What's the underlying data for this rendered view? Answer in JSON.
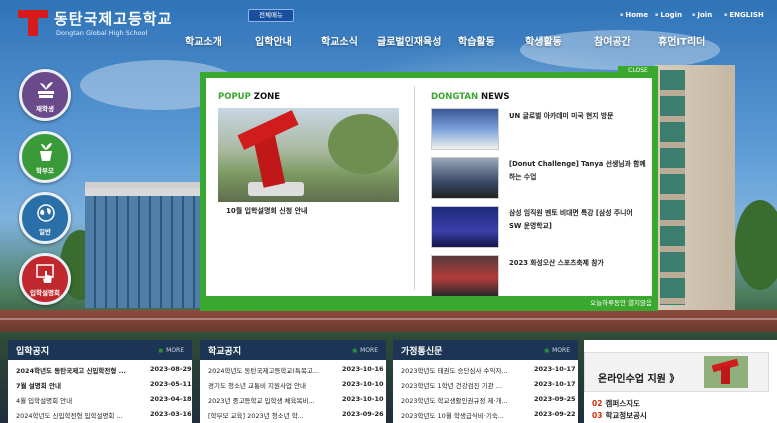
{
  "header": {
    "school_name": "동탄국제고등학교",
    "school_name_en": "Dongtan Global High School",
    "all_menu": "전체메뉴",
    "util_links": [
      "Home",
      "Login",
      "Join",
      "ENGLISH"
    ]
  },
  "gnb": [
    "학교소개",
    "입학안내",
    "학교소식",
    "글로벌인재육성",
    "학습활동",
    "학생활동",
    "참여공간",
    "휴먼IT리더"
  ],
  "side_menu": [
    {
      "label": "재학생",
      "color": "#6b4a8c"
    },
    {
      "label": "학부모",
      "color": "#3a9a3a"
    },
    {
      "label": "일반",
      "color": "#2a6fa8"
    },
    {
      "label": "입학설명회",
      "color": "#c0282e"
    }
  ],
  "popup": {
    "close": "CLOSE",
    "popup_zone_a": "POPUP",
    "popup_zone_b": " ZONE",
    "popup_caption": "10월 입학설명회 신청 안내",
    "news_a": "DONGTAN",
    "news_b": " NEWS",
    "news": [
      "UN 글로벌 아카데미 미국 현지 방문",
      "[Donut Challenge] Tanya 선생님과 함께 하는 수업",
      "삼성 임직원 멘토 비대면 특강 [삼성 주니어 SW 운영학교]",
      "2023 화성오산 스포츠축제 참가"
    ],
    "footer": "오늘하루동안 열지않음"
  },
  "boards": [
    {
      "title": "입학공지",
      "more": "MORE",
      "rows": [
        {
          "text": "2024학년도 동탄국제고 신입학전형 ...",
          "date": "2023-08-29",
          "bold": true
        },
        {
          "text": "7월 설명회 안내",
          "date": "2023-05-11",
          "bold": true
        },
        {
          "text": "4월 입학설명회 안내",
          "date": "2023-04-18",
          "bold": false
        },
        {
          "text": "2024학년도 신입학전형 입학설명회 ...",
          "date": "2023-03-16",
          "bold": false
        }
      ]
    },
    {
      "title": "학교공지",
      "more": "MORE",
      "rows": [
        {
          "text": "2024학년도 동탄국제고등학교(특목고...",
          "date": "2023-10-16",
          "bold": false
        },
        {
          "text": "경기도 청소년 교통비 지원사업 안내",
          "date": "2023-10-10",
          "bold": false
        },
        {
          "text": "2023년 중고등학교 입학생 체육복비...",
          "date": "2023-10-10",
          "bold": false
        },
        {
          "text": "[학부모 교육] 2023년 청소년 학...",
          "date": "2023-09-26",
          "bold": false
        }
      ]
    },
    {
      "title": "가정통신문",
      "more": "MORE",
      "rows": [
        {
          "text": "2023학년도 태권도 승단심사 수익자...",
          "date": "2023-10-17",
          "bold": false
        },
        {
          "text": "2023학년도 1학년 건강검진 기관 ...",
          "date": "2023-10-17",
          "bold": false
        },
        {
          "text": "2023학년도 학교생활인권규정 제·개...",
          "date": "2023-09-25",
          "bold": false
        },
        {
          "text": "2023학년도 10월 학생급식비·기숙...",
          "date": "2023-09-22",
          "bold": false
        }
      ]
    }
  ],
  "online": {
    "banner": "온라인수업 지원 》",
    "quick": [
      {
        "num": "02",
        "label": "캠퍼스지도"
      },
      {
        "num": "03",
        "label": "학교정보공시"
      }
    ]
  }
}
